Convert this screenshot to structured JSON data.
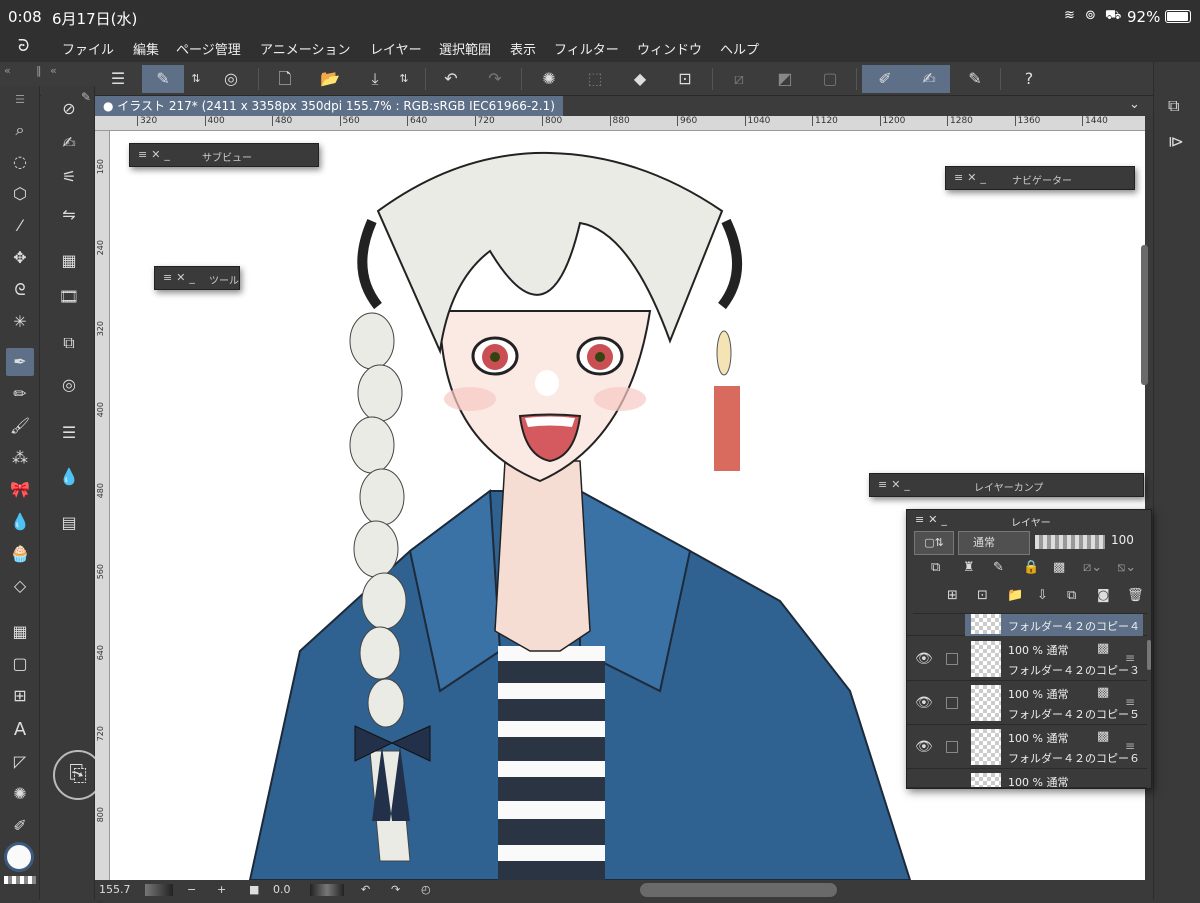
{
  "status_bar": {
    "time": "0:08",
    "date": "6月17日(水)",
    "battery": "92%"
  },
  "menu": [
    "ファイル",
    "編集",
    "ページ管理",
    "アニメーション",
    "レイヤー",
    "選択範囲",
    "表示",
    "フィルター",
    "ウィンドウ",
    "ヘルプ"
  ],
  "document": {
    "tab_title": "● イラスト 217* (2411 x 3358px 350dpi 155.7% : RGB:sRGB IEC61966-2.1)"
  },
  "rulers": {
    "horizontal": [
      "320",
      "400",
      "480",
      "560",
      "640",
      "720",
      "800",
      "880",
      "960",
      "1040",
      "1120",
      "1200",
      "1280",
      "1360",
      "1440"
    ],
    "vertical": [
      "160",
      "240",
      "320",
      "400",
      "480",
      "560",
      "640",
      "720",
      "800",
      "880"
    ]
  },
  "panels": {
    "subview": "サブビュー",
    "tool": "ツール",
    "navigator": "ナビゲーター",
    "layer_comp": "レイヤーカンプ",
    "layer": "レイヤー"
  },
  "layer_panel": {
    "blend_mode": "通常",
    "opacity": "100",
    "layers": [
      {
        "opacity_mode": "",
        "name": "フォルダー４２のコピー４",
        "selected": true
      },
      {
        "opacity_mode": "100 % 通常",
        "name": "フォルダー４２のコピー３",
        "selected": false
      },
      {
        "opacity_mode": "100 % 通常",
        "name": "フォルダー４２のコピー５",
        "selected": false
      },
      {
        "opacity_mode": "100 % 通常",
        "name": "フォルダー４２のコピー６",
        "selected": false
      },
      {
        "opacity_mode": "100 % 通常",
        "name": "",
        "selected": false
      }
    ]
  },
  "bottom_bar": {
    "zoom": "155.7",
    "rotation": "0.0"
  },
  "colors": {
    "accent": "#5e6f88",
    "jacket": "#2f6191",
    "stripe_dark": "#2b3443",
    "hair": "#ebebe6",
    "tassel": "#d86a5e"
  }
}
